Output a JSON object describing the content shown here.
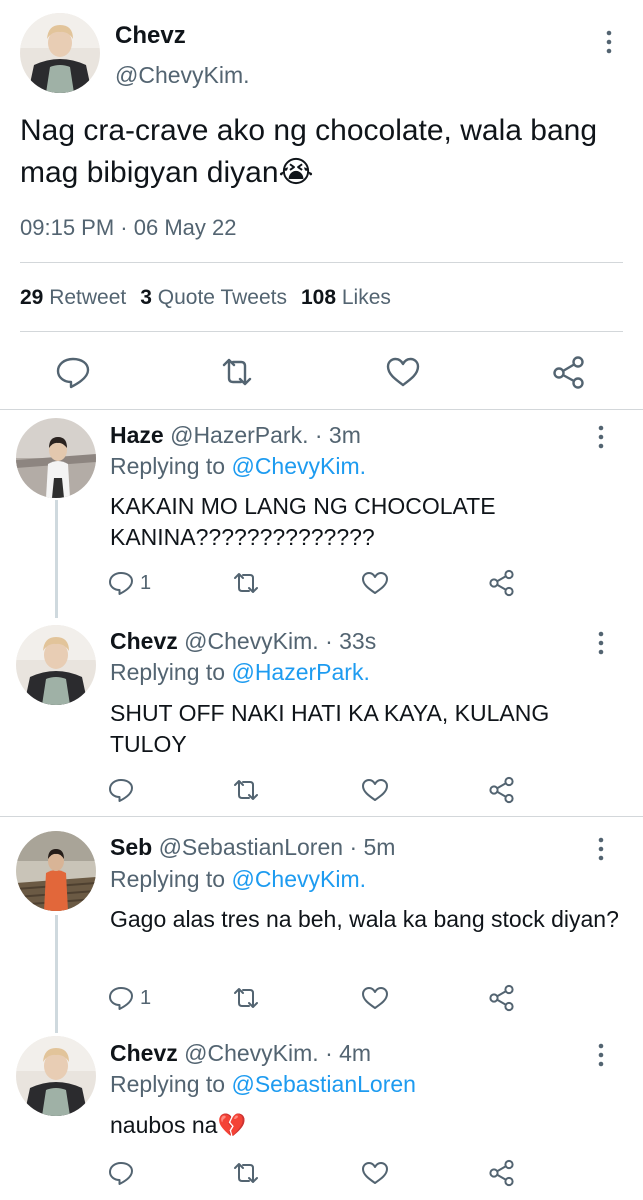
{
  "main_tweet": {
    "name": "Chevz",
    "handle": "@ChevyKim.",
    "text": "Nag cra-crave ako ng chocolate, wala bang mag bibigyan diyan",
    "emoji": "😭",
    "time": "09:15 PM",
    "separator": "·",
    "date": "06 May 22",
    "stats": {
      "retweets_count": "29",
      "retweets_label": "Retweet",
      "quotes_count": "3",
      "quotes_label": "Quote Tweets",
      "likes_count": "108",
      "likes_label": "Likes"
    }
  },
  "replies": [
    {
      "name": "Haze",
      "handle": "@HazerPark.",
      "time": "· 3m",
      "replying_prefix": "Replying to",
      "replying_to": "@ChevyKim.",
      "text": "KAKAIN MO LANG NG CHOCOLATE KANINA??????????????",
      "reply_count": "1"
    },
    {
      "name": "Chevz",
      "handle": "@ChevyKim.",
      "time": "· 33s",
      "replying_prefix": "Replying to",
      "replying_to": "@HazerPark.",
      "text": "SHUT OFF NAKI HATI KA KAYA, KULANG TULOY",
      "reply_count": ""
    },
    {
      "name": "Seb",
      "handle": "@SebastianLoren",
      "time": "· 5m",
      "replying_prefix": "Replying to",
      "replying_to": "@ChevyKim.",
      "text": "Gago alas tres na beh, wala ka bang stock diyan?",
      "reply_count": "1"
    },
    {
      "name": "Chevz",
      "handle": "@ChevyKim.",
      "time": "· 4m",
      "replying_prefix": "Replying to",
      "replying_to": "@SebastianLoren",
      "text": "naubos na",
      "emoji": "💔",
      "reply_count": ""
    }
  ],
  "icons": {
    "reply": "reply-icon",
    "retweet": "retweet-icon",
    "like": "heart-icon",
    "share": "share-icon",
    "more": "more-vertical-icon"
  },
  "colors": {
    "text": "#0f1419",
    "secondary": "#536471",
    "link": "#1d9bf0",
    "divider": "#d3d7da"
  }
}
